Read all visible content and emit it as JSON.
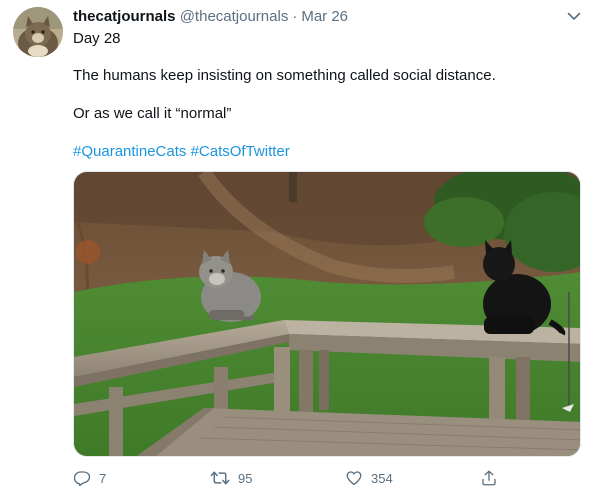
{
  "tweet": {
    "display_name": "thecatjournals",
    "handle": "@thecatjournals",
    "separator": "·",
    "date": "Mar 26",
    "lines": [
      "Day 28",
      "The humans keep insisting on something called social distance.",
      "Or as we call it “normal”"
    ],
    "hashtags": [
      "#QuarantineCats",
      "#CatsOfTwitter"
    ]
  },
  "actions": {
    "reply_count": "7",
    "retweet_count": "95",
    "like_count": "354"
  },
  "colors": {
    "link": "#1b95e0",
    "secondary_text": "#5b7083"
  },
  "icons": {
    "menu": "chevron-down-icon",
    "reply": "reply-icon",
    "retweet": "retweet-icon",
    "like": "heart-icon",
    "share": "share-icon"
  }
}
